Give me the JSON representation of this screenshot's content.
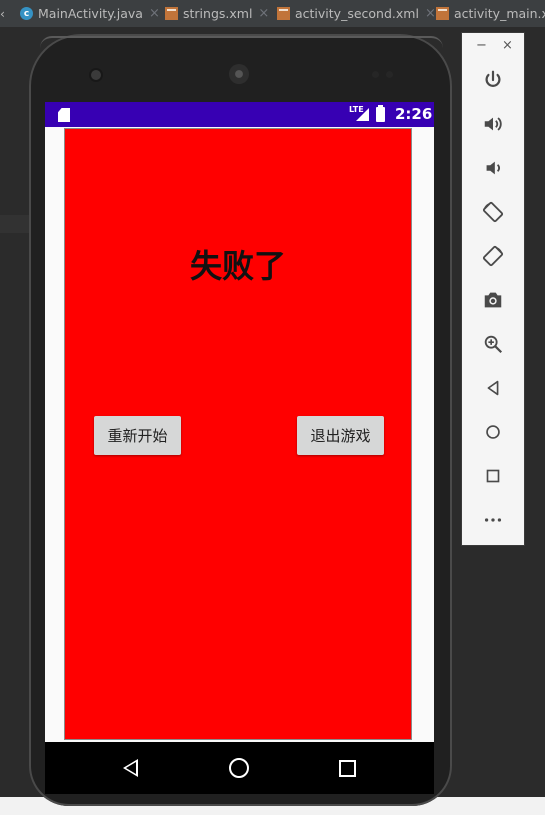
{
  "ide": {
    "tabs": [
      {
        "label": "MainActivity.java",
        "icon": "java-class-icon"
      },
      {
        "label": "strings.xml",
        "icon": "xml-file-icon"
      },
      {
        "label": "activity_second.xml",
        "icon": "xml-file-icon"
      },
      {
        "label": "activity_main.xm",
        "icon": "xml-file-icon"
      }
    ],
    "close_glyph": "×",
    "left_arrow": "‹"
  },
  "status_bar": {
    "network": "LTE",
    "time": "2:26",
    "color": "#3700b3"
  },
  "app": {
    "title": "失败了",
    "background_color": "#ff0000",
    "restart_label": "重新开始",
    "exit_label": "退出游戏"
  },
  "emulator_toolbar": {
    "minimize": "−",
    "close": "×",
    "items": [
      "power-icon",
      "volume-up-icon",
      "volume-down-icon",
      "rotate-left-icon",
      "rotate-right-icon",
      "camera-icon",
      "zoom-icon",
      "back-icon",
      "home-icon",
      "overview-icon",
      "more-icon"
    ]
  }
}
